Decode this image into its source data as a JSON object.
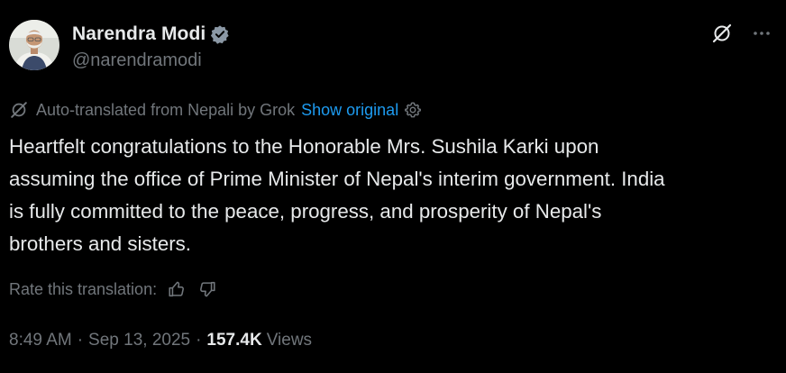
{
  "author": {
    "display_name": "Narendra Modi",
    "handle": "@narendramodi",
    "verified": true,
    "avatar": "portrait-photo"
  },
  "header_actions": {
    "grok_icon": "grok-slash-circle-icon",
    "more_icon": "more-horizontal-icon"
  },
  "translation": {
    "notice": "Auto-translated from Nepali by Grok",
    "show_original_label": "Show original",
    "settings_icon": "gear-icon"
  },
  "tweet": {
    "text": "Heartfelt congratulations to the Honorable Mrs. Sushila Karki upon\nassuming the office of Prime Minister of Nepal's interim government. India\nis fully committed to the peace, progress, and prosperity of Nepal's\nbrothers and sisters."
  },
  "rating": {
    "label": "Rate this translation:",
    "thumbs_up_icon": "thumbs-up-icon",
    "thumbs_down_icon": "thumbs-down-icon"
  },
  "meta": {
    "time": "8:49 AM",
    "separator": "·",
    "date": "Sep 13, 2025",
    "views_count": "157.4K",
    "views_label": "Views"
  },
  "colors": {
    "background": "#000000",
    "text_primary": "#e7e9ea",
    "text_secondary": "#71767b",
    "link": "#1d9bf0",
    "verified_badge": "#8b98a5"
  }
}
